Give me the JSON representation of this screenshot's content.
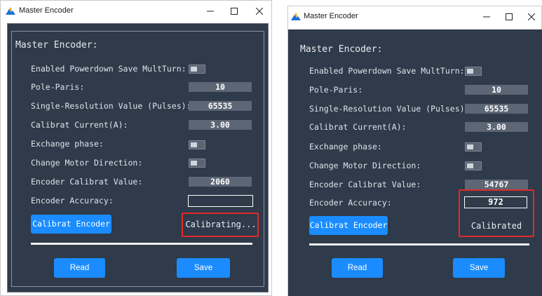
{
  "colors": {
    "panel": "#2f3a4a",
    "accent": "#1a8cff",
    "highlight": "#e02a2a"
  },
  "left": {
    "window_title": "Master Encoder",
    "section_title": "Master Encoder:",
    "fields": {
      "powerdown_label": "Enabled Powerdown Save MultTurn:",
      "pole_label": "Pole-Paris:",
      "pole_value": "10",
      "resolution_label": "Single-Resolution Value (Pulses):",
      "resolution_value": "65535",
      "current_label": "Calibrat Current(A):",
      "current_value": "3.00",
      "exchange_label": "Exchange phase:",
      "direction_label": "Change Motor Direction:",
      "calib_value_label": "Encoder Calibrat Value:",
      "calib_value": "2060",
      "accuracy_label": "Encoder Accuracy:",
      "accuracy_value": ""
    },
    "calibrate_button": "Calibrat Encoder",
    "status": "Calibrating...",
    "read_button": "Read",
    "save_button": "Save"
  },
  "right": {
    "window_title": "Master Encoder",
    "section_title": "Master Encoder:",
    "fields": {
      "powerdown_label": "Enabled Powerdown Save MultTurn:",
      "pole_label": "Pole-Paris:",
      "pole_value": "10",
      "resolution_label": "Single-Resolution Value (Pulses):",
      "resolution_value": "65535",
      "current_label": "Calibrat Current(A):",
      "current_value": "3.00",
      "exchange_label": "Exchange phase:",
      "direction_label": "Change Motor Direction:",
      "calib_value_label": "Encoder Calibrat Value:",
      "calib_value": "54767",
      "accuracy_label": "Encoder Accuracy:",
      "accuracy_value": "972"
    },
    "calibrate_button": "Calibrat Encoder",
    "status": "Calibrated",
    "read_button": "Read",
    "save_button": "Save"
  }
}
